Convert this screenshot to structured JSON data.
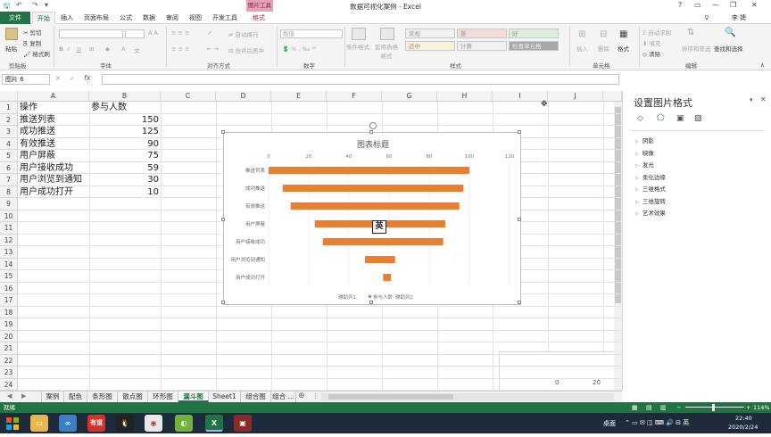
{
  "window": {
    "title": "数据可视化案例 - Excel",
    "context_tab_group": "图片工具",
    "user": "李 婕"
  },
  "tabs": [
    "文件",
    "开始",
    "插入",
    "页面布局",
    "公式",
    "数据",
    "审阅",
    "视图",
    "开发工具",
    "格式"
  ],
  "ribbon": {
    "clipboard": {
      "paste": "粘贴",
      "cut": "剪切",
      "copy": "复制",
      "format_painter": "格式刷",
      "label": "剪贴板"
    },
    "font": {
      "label": "字体"
    },
    "alignment": {
      "wrap": "自动换行",
      "merge": "合并后居中",
      "label": "对齐方式"
    },
    "number": {
      "format": "数值",
      "label": "数字"
    },
    "styles": {
      "conditional": "条件格式",
      "table": "套用表格格式",
      "normal": "常规",
      "bad": "差",
      "good": "好",
      "neutral": "适中",
      "calc": "计算",
      "check": "检查单元格",
      "label": "样式"
    },
    "cells": {
      "insert": "插入",
      "delete": "删除",
      "format": "格式",
      "label": "单元格"
    },
    "editing": {
      "autosum": "自动求和",
      "fill": "填充",
      "clear": "清除",
      "sort": "排序和筛选",
      "find": "查找和选择",
      "label": "编辑"
    }
  },
  "formula_bar": {
    "name_box": "图片 6",
    "fx": "fx"
  },
  "columns": [
    "A",
    "B",
    "C",
    "D",
    "E",
    "F",
    "G",
    "H",
    "I",
    "J"
  ],
  "rows": [
    "1",
    "2",
    "3",
    "4",
    "5",
    "6",
    "7",
    "8",
    "9",
    "10",
    "11",
    "12",
    "13",
    "14",
    "15",
    "16",
    "17",
    "18",
    "19",
    "20",
    "21",
    "22",
    "23",
    "24"
  ],
  "table": {
    "headers": [
      "操作",
      "参与人数"
    ],
    "rows": [
      [
        "推送列表",
        "150"
      ],
      [
        "成功推送",
        "125"
      ],
      [
        "有效推送",
        "90"
      ],
      [
        "用户屏蔽",
        "75"
      ],
      [
        "用户接收成功",
        "59"
      ],
      [
        "用户浏览到通知",
        "30"
      ],
      [
        "用户成功打开",
        "10"
      ]
    ]
  },
  "chart_data": {
    "type": "bar",
    "title": "图表标题",
    "orientation": "horizontal",
    "stacked": true,
    "categories": [
      "推送列表",
      "成功推送",
      "有效推送",
      "用户屏蔽",
      "用户接收成功",
      "用户浏览到通知",
      "用户成功打开"
    ],
    "series": [
      {
        "name": "辅助列1",
        "values": [
          0,
          7,
          11,
          23,
          27,
          48,
          57
        ],
        "visible": false
      },
      {
        "name": "参与人数",
        "values": [
          100,
          90,
          84,
          65,
          60,
          15,
          4
        ],
        "color": "#ED7D31"
      },
      {
        "name": "辅助列2",
        "values": [
          0,
          7,
          11,
          23,
          27,
          48,
          57
        ],
        "visible": false
      }
    ],
    "xlim": [
      0,
      120
    ],
    "xticks": [
      0,
      20,
      40,
      60,
      80,
      100,
      120
    ],
    "legend": "bottom",
    "grid": true
  },
  "ime_indicator": "英",
  "pane": {
    "title": "设置图片格式",
    "items": [
      "阴影",
      "映像",
      "发光",
      "柔化边缘",
      "三维格式",
      "三维旋转",
      "艺术效果"
    ],
    "peek_values": [
      "0",
      "20"
    ]
  },
  "sheet_tabs": [
    "案例",
    "配色",
    "条形图",
    "散点图",
    "环形图",
    "漏斗图",
    "Sheet1",
    "组合图",
    "组合 ..."
  ],
  "active_sheet": "漏斗图",
  "status": {
    "mode": "就绪",
    "zoom": "114%"
  },
  "taskbar": {
    "desktop": "桌面",
    "time": "22:40",
    "date": "2020/2/24",
    "app_youdao": "有道",
    "app_excel": "X"
  }
}
